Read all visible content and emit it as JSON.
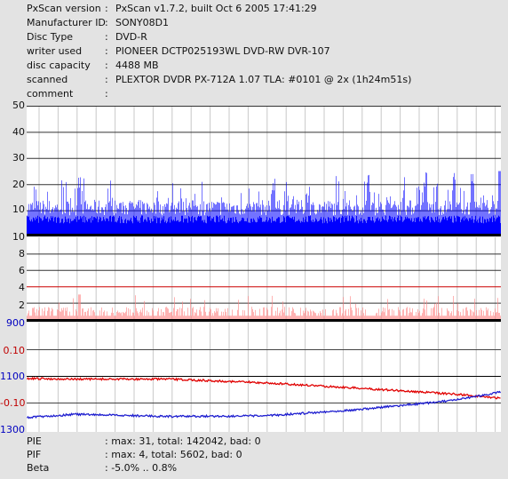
{
  "info": [
    {
      "label": "PxScan version",
      "value": "PxScan v1.7.2, built Oct  6 2005 17:41:29"
    },
    {
      "label": "Manufacturer ID",
      "value": "SONY08D1"
    },
    {
      "label": "Disc Type",
      "value": "DVD-R"
    },
    {
      "label": "writer used",
      "value": "PIONEER DCTP025193WL DVD-RW DVR-107"
    },
    {
      "label": "disc capacity",
      "value": "4488 MB"
    },
    {
      "label": "scanned",
      "value": "PLEXTOR DVDR PX-712A 1.07 TLA: #0101 @ 2x (1h24m51s)"
    },
    {
      "label": "comment",
      "value": ""
    }
  ],
  "separator": ":",
  "footer": [
    {
      "label": "PIE",
      "value": ": max: 31, total: 142042, bad: 0"
    },
    {
      "label": "PIF",
      "value": ": max: 4, total: 5602, bad: 0"
    },
    {
      "label": "Beta",
      "value": ": -5.0% .. 0.8%"
    }
  ],
  "colors": {
    "pie": "#0000ff",
    "pif": "#ff8080",
    "beta_red": "#e00000",
    "beta_blue": "#2020d0",
    "limit": "#cc0000"
  },
  "chart_data": [
    {
      "type": "area",
      "name": "PIE",
      "yticks": [
        50,
        40,
        30,
        20,
        10
      ],
      "ylim": [
        0,
        50
      ],
      "baseline_label": "10",
      "typical_level": 10,
      "max_value": 31,
      "total": 142042,
      "spikes_at_percent": [
        11,
        52,
        72,
        84,
        90,
        94,
        100
      ]
    },
    {
      "type": "area",
      "name": "PIF",
      "yticks": [
        8,
        6,
        4,
        2
      ],
      "ylim": [
        0,
        10
      ],
      "limit_line": 4,
      "max_value": 4,
      "total": 5602
    },
    {
      "type": "line",
      "name": "Beta",
      "yticks": [
        {
          "label": "900",
          "color": "#0000c0"
        },
        {
          "label": "0.10",
          "color": "#c00000"
        },
        {
          "label": "1100",
          "color": "#0000c0"
        },
        {
          "label": "-0.10",
          "color": "#c00000"
        },
        {
          "label": "1300",
          "color": "#0000c0"
        }
      ],
      "series": [
        {
          "color": "#e00000",
          "x_percent": [
            0,
            10,
            30,
            50,
            70,
            90,
            100
          ],
          "y_level": [
            -0.5,
            -0.6,
            -0.6,
            -1.3,
            -2.3,
            -3.4,
            -4.2
          ]
        },
        {
          "color": "#2020d0",
          "x_percent": [
            0,
            10,
            30,
            50,
            70,
            90,
            100
          ],
          "y_level": [
            -7.8,
            -7.2,
            -7.6,
            -7.5,
            -6.3,
            -4.6,
            -3.0
          ]
        }
      ]
    }
  ]
}
